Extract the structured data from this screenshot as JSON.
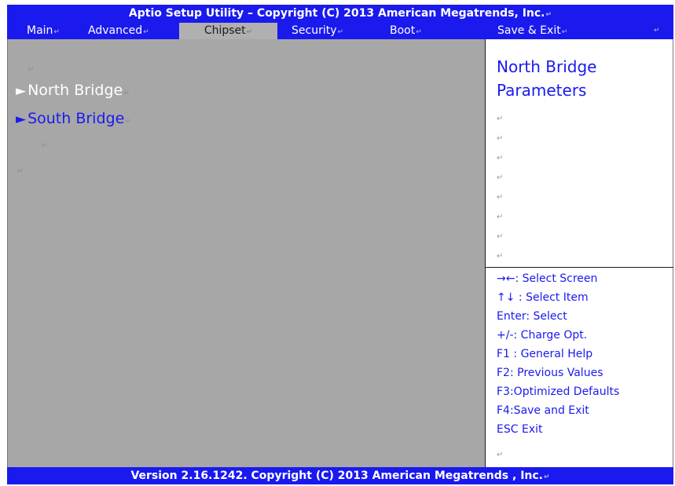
{
  "title": "Aptio Setup Utility – Copyright (C) 2013 American Megatrends, Inc.",
  "menu": {
    "items": [
      {
        "label": "Main"
      },
      {
        "label": "Advanced"
      },
      {
        "label": "Chipset"
      },
      {
        "label": "Security"
      },
      {
        "label": "Boot"
      },
      {
        "label": "Save & Exit"
      }
    ],
    "active": "Chipset"
  },
  "content": {
    "items": [
      {
        "label": "North Bridge",
        "arrow": "►",
        "selected": true
      },
      {
        "label": "South Bridge",
        "arrow": "►",
        "selected": false
      }
    ]
  },
  "help": {
    "title": "North Bridge Parameters"
  },
  "keys": [
    "→←: Select Screen",
    "↑↓   : Select Item",
    "Enter:   Select",
    "+/-: Charge Opt.",
    "F1 : General Help",
    "F2: Previous Values",
    "F3:Optimized Defaults",
    "F4:Save and Exit",
    "ESC   Exit"
  ],
  "footer": "Version 2.16.1242. Copyright (C) 2013 American Megatrends , Inc.",
  "colors": {
    "bar_blue": "#1a1aee",
    "panel_gray": "#a7a7a7",
    "selected_text": "#ffffff",
    "item_text": "#1a1aee"
  }
}
